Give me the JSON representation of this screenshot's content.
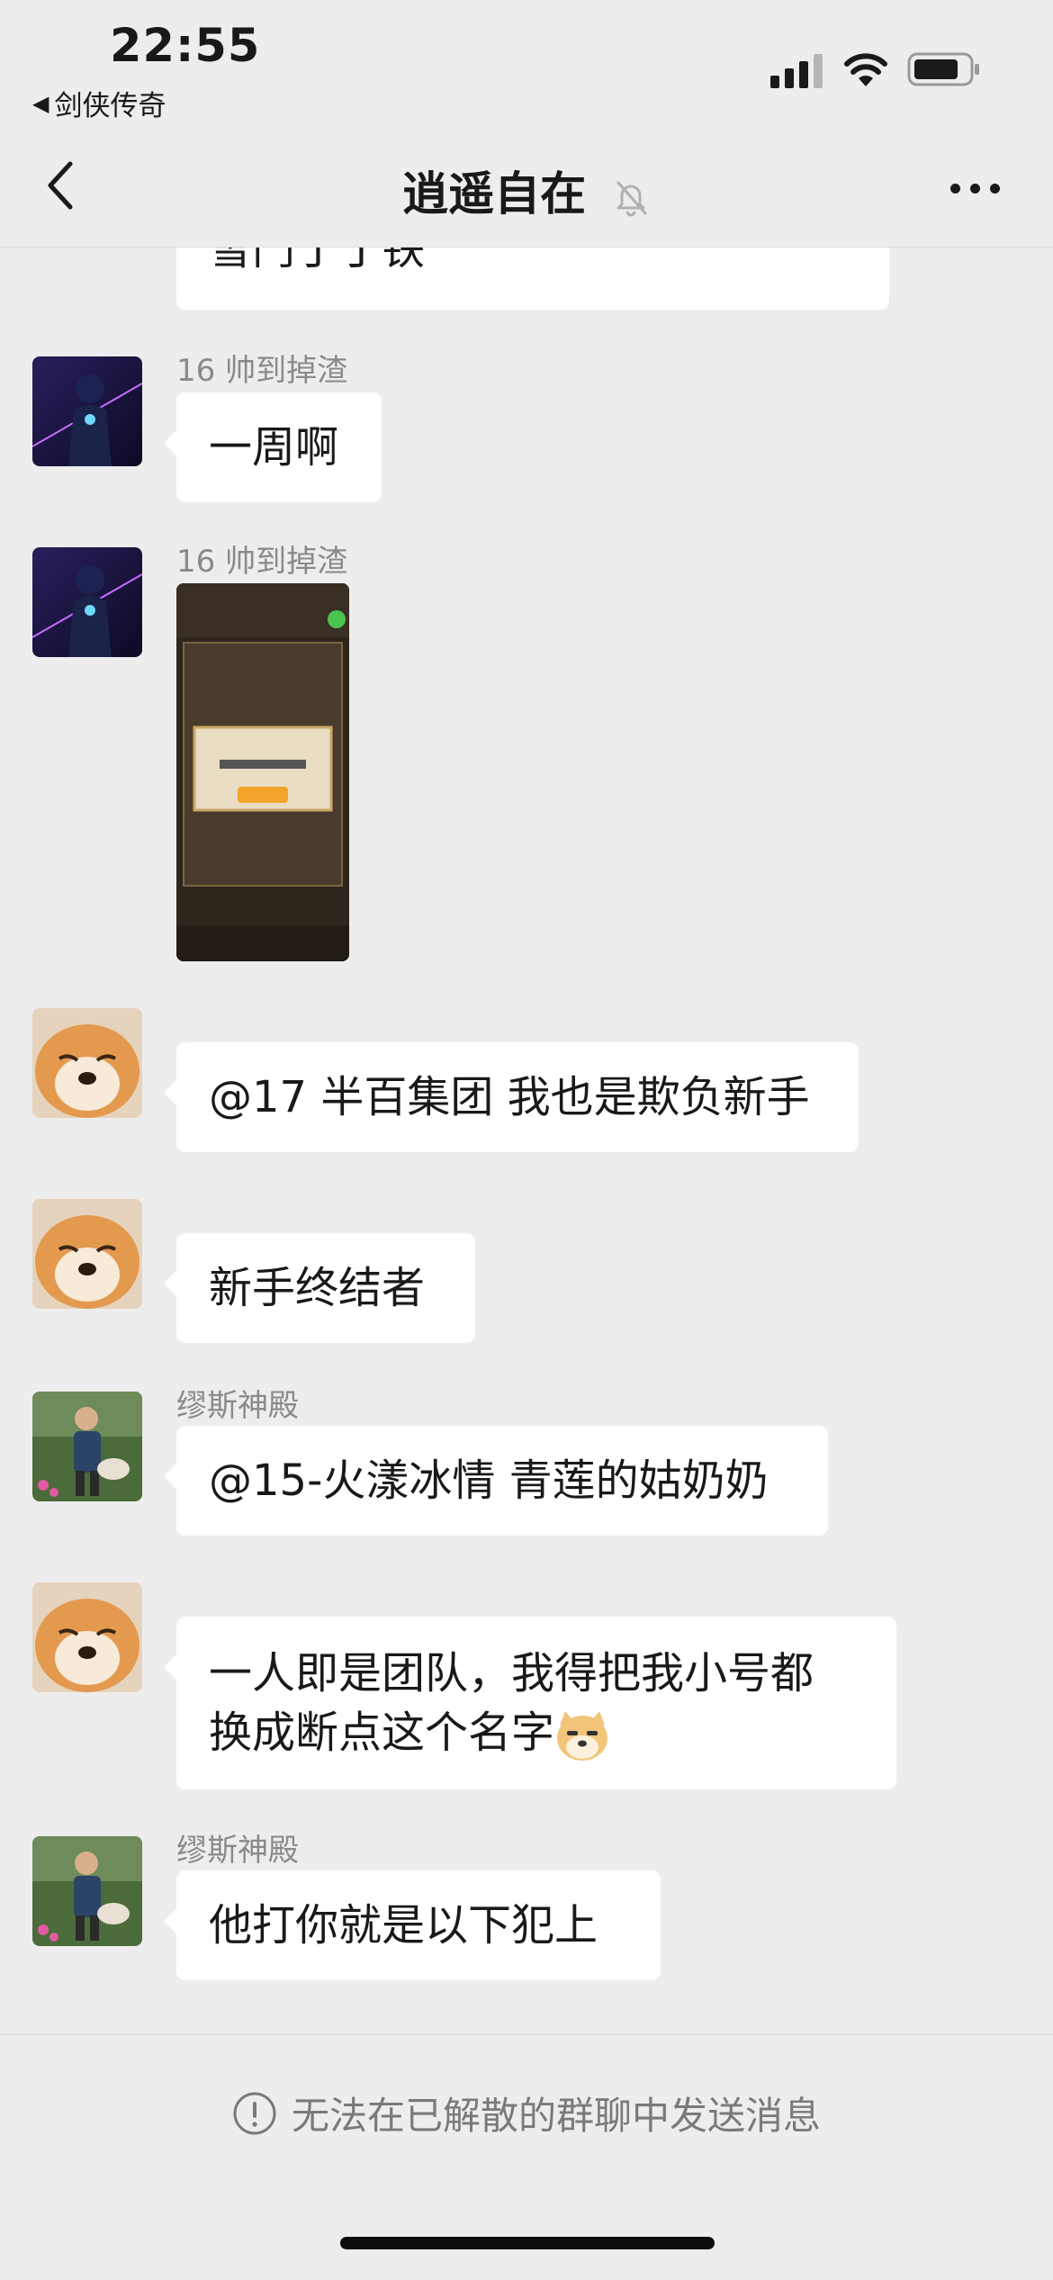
{
  "status_bar": {
    "time": "22:55",
    "back_app": "剑侠传奇",
    "back_arrow": "◀"
  },
  "nav": {
    "title": "逍遥自在",
    "mute_icon": "bell-slash-icon",
    "back_icon": "chevron-left-icon",
    "more_icon": "ellipsis-icon"
  },
  "messages": [
    {
      "type": "text",
      "sender": "",
      "text": "雪门丁丁铁",
      "partial": true
    },
    {
      "type": "text",
      "sender": "16 帅到掉渣",
      "text": "一周啊",
      "avatar": "anime-boy"
    },
    {
      "type": "image",
      "sender": "16 帅到掉渣",
      "avatar": "anime-boy"
    },
    {
      "type": "text",
      "sender": "",
      "text": "@17 半百集团 我也是欺负新手",
      "avatar": "shiba-dog"
    },
    {
      "type": "text",
      "sender": "",
      "text": "新手终结者",
      "avatar": "shiba-dog"
    },
    {
      "type": "text",
      "sender": "缪斯神殿",
      "text": "@15-火漾冰情 青莲的姑奶奶",
      "avatar": "child-dog-photo"
    },
    {
      "type": "text",
      "sender": "",
      "text_line1": "一人即是团队，我得把我小号都",
      "text_line2": "换成断点这个名字",
      "emoji": "doge-emoji",
      "avatar": "shiba-dog"
    },
    {
      "type": "text",
      "sender": "缪斯神殿",
      "text": "他打你就是以下犯上",
      "avatar": "child-dog-photo"
    }
  ],
  "bottom": {
    "notice": "无法在已解散的群聊中发送消息",
    "notice_icon": "info-circle-icon"
  },
  "colors": {
    "background": "#ededed",
    "bubble": "#ffffff",
    "sender_text": "#8a8a8a"
  }
}
